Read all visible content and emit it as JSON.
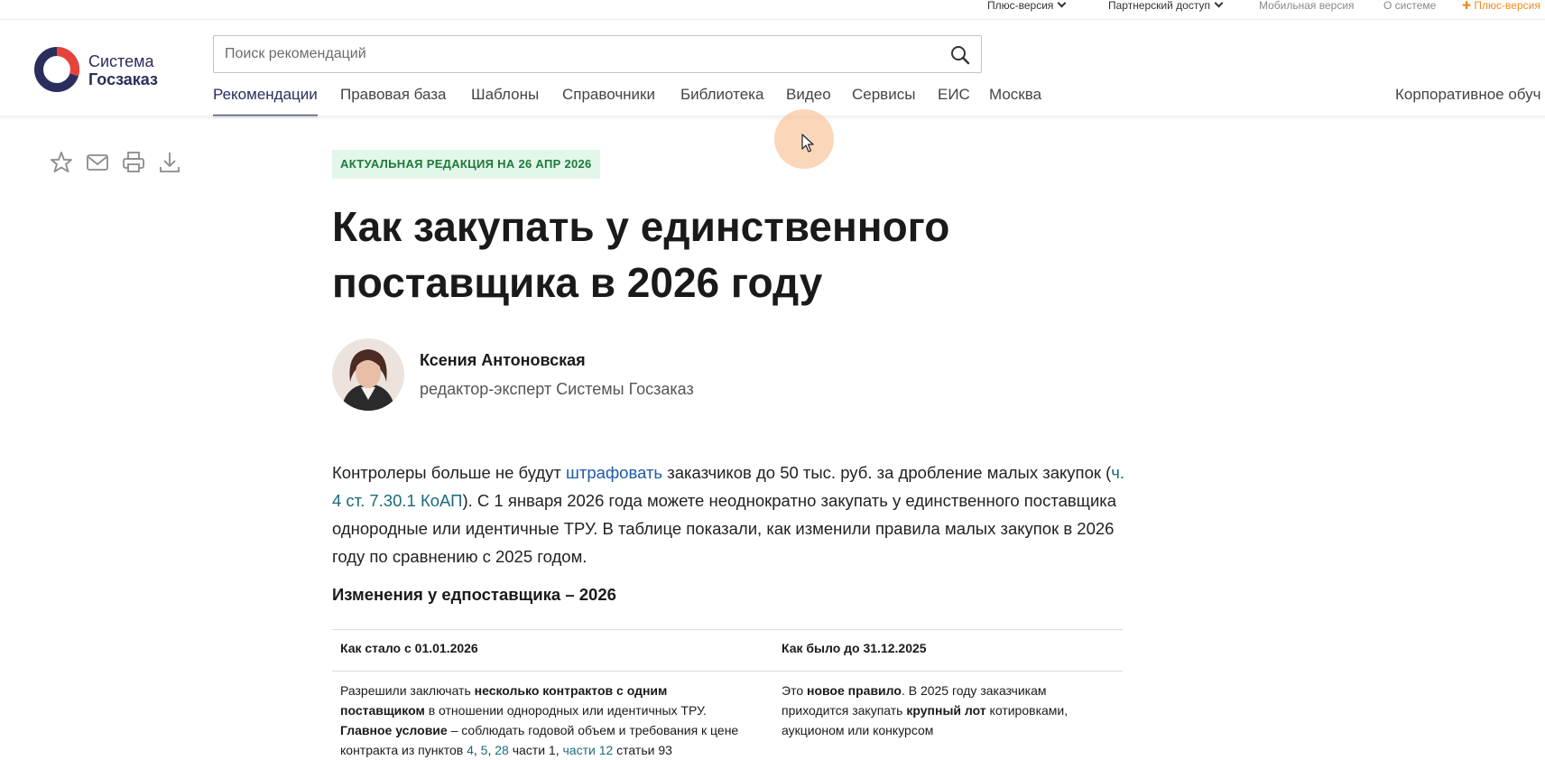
{
  "topbar": {
    "plus_version": "Плюс-версия",
    "partner_access": "Партнерский доступ",
    "mobile_version": "Мобильная версия",
    "about": "О системе",
    "plus_version_promo": "Плюс-версия"
  },
  "logo": {
    "line1": "Система",
    "line2": "Госзаказ",
    "colors": {
      "ring": "#2a2e5c",
      "accent": "#e8433a"
    }
  },
  "search": {
    "placeholder": "Поиск рекомендаций",
    "value": "",
    "icon": "search-icon"
  },
  "nav": {
    "items": [
      {
        "label": "Рекомендации",
        "active": true
      },
      {
        "label": "Правовая база"
      },
      {
        "label": "Шаблоны"
      },
      {
        "label": "Справочники"
      },
      {
        "label": "Библиотека"
      },
      {
        "label": "Видео"
      },
      {
        "label": "Сервисы"
      },
      {
        "label": "ЕИС"
      },
      {
        "label": "Москва"
      }
    ],
    "corporate": "Корпоративное обуч"
  },
  "tools": [
    "star-icon",
    "mail-icon",
    "print-icon",
    "download-icon"
  ],
  "article": {
    "badge": "АКТУАЛЬНАЯ РЕДАКЦИЯ НА 26 АПР 2026",
    "title": "Как закупать у единственного поставщика в 2026 году",
    "author": {
      "name": "Ксения Антоновская",
      "role": "редактор-эксперт Системы Госзаказ"
    },
    "lead": {
      "p1": "Контролеры больше не будут ",
      "link1": "штрафовать",
      "p2": " заказчиков до 50 тыс. руб. за дробление малых закупок (",
      "link2": "ч. 4 ст. 7.30.1 КоАП",
      "p3": "). С 1 января 2026 года можете неоднократно закупать у единственного поставщика однородные или идентичные ТРУ. В таблице показали, как изменили правила малых закупок в 2026 году по сравнению с 2025 годом."
    },
    "table": {
      "title": "Изменения у едпоставщика – 2026",
      "col1_header": "Как стало с 01.01.2026",
      "col2_header": "Как было до 31.12.2025",
      "row1": {
        "c1_a": "Разрешили заключать ",
        "c1_b": "несколько контрактов с одним поставщиком",
        "c1_c": " в отношении однородных или идентичных ТРУ. ",
        "c1_d": "Главное условие",
        "c1_e": " – соблюдать годовой объем и требования к цене контракта из пунктов ",
        "c1_l1": "4",
        "c1_s1": ", ",
        "c1_l2": "5",
        "c1_s2": ", ",
        "c1_l3": "28",
        "c1_f": " части 1, ",
        "c1_l4": "части 12",
        "c1_g": " статьи 93",
        "c2_a": "Это ",
        "c2_b": "новое правило",
        "c2_c": ". В 2025 году заказчикам приходится закупать ",
        "c2_d": "крупный лот",
        "c2_e": " котировками, аукционом или конкурсом"
      }
    }
  }
}
